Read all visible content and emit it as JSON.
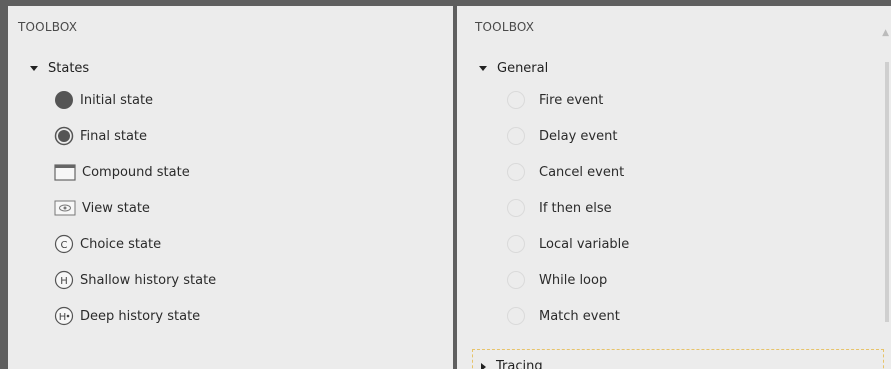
{
  "left_panel": {
    "title": "TOOLBOX",
    "group": "States",
    "items": [
      {
        "label": "Initial state",
        "icon": "filled-circle-icon"
      },
      {
        "label": "Final state",
        "icon": "ring-circle-icon"
      },
      {
        "label": "Compound state",
        "icon": "compound-state-icon"
      },
      {
        "label": "View state",
        "icon": "view-state-icon"
      },
      {
        "label": "Choice state",
        "icon": "choice-c-icon"
      },
      {
        "label": "Shallow history state",
        "icon": "history-h-icon"
      },
      {
        "label": "Deep history state",
        "icon": "deep-history-h-icon"
      }
    ]
  },
  "right_panel": {
    "title": "TOOLBOX",
    "group": "General",
    "items": [
      {
        "label": "Fire event"
      },
      {
        "label": "Delay event"
      },
      {
        "label": "Cancel event"
      },
      {
        "label": "If then else"
      },
      {
        "label": "Local variable"
      },
      {
        "label": "While loop"
      },
      {
        "label": "Match event"
      }
    ],
    "collapsed_group": "Tracing"
  }
}
